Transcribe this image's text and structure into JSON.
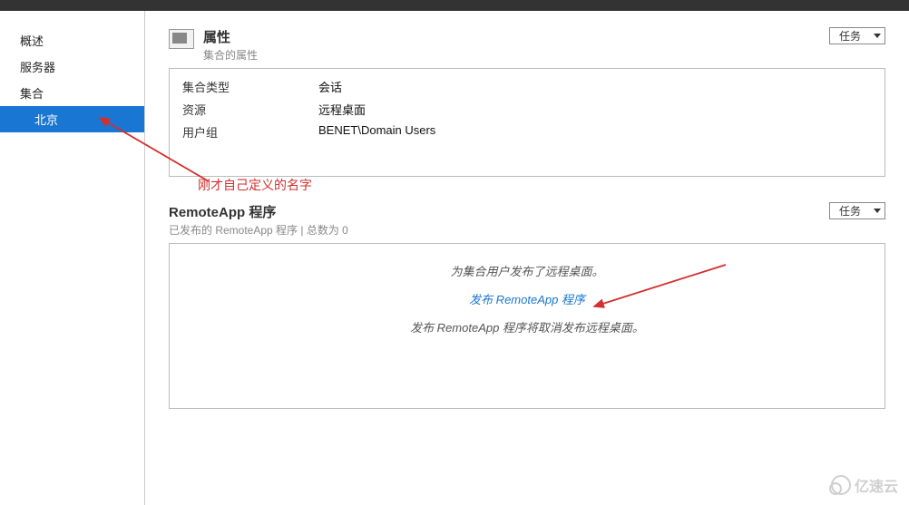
{
  "sidebar": {
    "items": [
      {
        "label": "概述"
      },
      {
        "label": "服务器"
      },
      {
        "label": "集合"
      },
      {
        "label": "北京"
      }
    ]
  },
  "properties": {
    "title": "属性",
    "subtitle": "集合的属性",
    "tasks_label": "任务",
    "rows": [
      {
        "label": "集合类型",
        "value": "会话"
      },
      {
        "label": "资源",
        "value": "远程桌面"
      },
      {
        "label": "用户组",
        "value": "BENET\\Domain Users"
      }
    ]
  },
  "remoteapp": {
    "title": "RemoteApp 程序",
    "subtitle": "已发布的 RemoteApp 程序 | 总数为 0",
    "tasks_label": "任务",
    "message1": "为集合用户发布了远程桌面。",
    "link_label": "发布 RemoteApp 程序",
    "message2": "发布 RemoteApp 程序将取消发布远程桌面。"
  },
  "annotation": {
    "text": "刚才自己定义的名字"
  },
  "watermark": {
    "text": "亿速云"
  }
}
